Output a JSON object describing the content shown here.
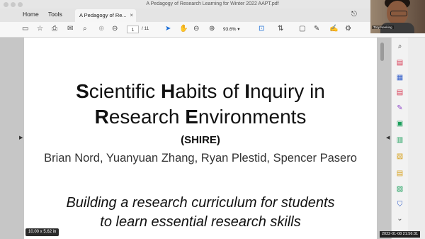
{
  "window": {
    "title": "A Pedagogy of Research Learning for Winter 2022 AAPT.pdf"
  },
  "tabs": {
    "home": "Home",
    "tools": "Tools",
    "document": "A Pedagogy of Re...",
    "close": "×"
  },
  "toolbar": {
    "page_current": "1",
    "page_total": "/ 11",
    "zoom": "93.6%",
    "icons": [
      "save-icon",
      "star-icon",
      "print-icon",
      "email-icon",
      "search-icon",
      "prev-page-icon",
      "next-page-icon",
      "select-cursor-icon",
      "hand-icon",
      "zoom-out-icon",
      "zoom-in-icon",
      "fit-page-icon",
      "scroll-mode-icon",
      "comment-icon",
      "highlight-icon",
      "sign-icon",
      "more-tools-icon"
    ]
  },
  "slide": {
    "title_line1": [
      "S",
      "cientific ",
      "H",
      "abits of ",
      "I",
      "nquiry in"
    ],
    "title_line2": [
      "R",
      "esearch ",
      "E",
      "nvironments"
    ],
    "acronym": "(SHIRE)",
    "authors": "Brian Nord, Yuanyuan Zhang, Ryan Plestid, Spencer Pasero",
    "subtitle_line1": "Building a research curriculum for students",
    "subtitle_line2": "to learn essential research skills"
  },
  "status": {
    "page_size": "10.00 x 5.62 in",
    "clock": "2022-01-08 21:56:31"
  },
  "video": {
    "name": "Troy Neeking"
  },
  "colors": {
    "accent": "#1a6dd6",
    "background": "#c6c6c6",
    "page": "#ffffff"
  }
}
